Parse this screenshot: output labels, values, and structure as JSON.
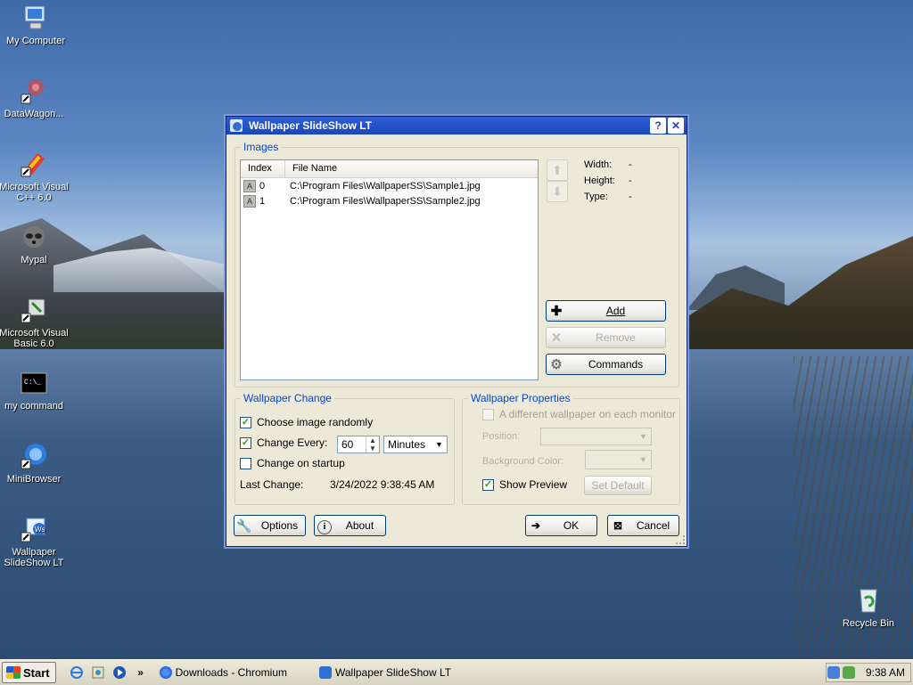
{
  "desktop": {
    "icons": [
      {
        "label": "My Computer"
      },
      {
        "label": "DataWagon..."
      },
      {
        "label": "Microsoft Visual C++ 6.0"
      },
      {
        "label": "Mypal"
      },
      {
        "label": "Microsoft Visual Basic 6.0"
      },
      {
        "label": "my command"
      },
      {
        "label": "MiniBrowser"
      },
      {
        "label": "Wallpaper SlideShow LT"
      },
      {
        "label": "Recycle Bin"
      }
    ]
  },
  "dialog": {
    "title": "Wallpaper SlideShow LT",
    "help_glyph": "?",
    "close_glyph": "✕",
    "images_group": {
      "title": "Images",
      "columns": [
        "Index",
        "File Name"
      ],
      "rows": [
        {
          "index": "0",
          "file": "C:\\Program Files\\WallpaperSS\\Sample1.jpg"
        },
        {
          "index": "1",
          "file": "C:\\Program Files\\WallpaperSS\\Sample2.jpg"
        }
      ],
      "width_label": "Width:",
      "width_value": "-",
      "height_label": "Height:",
      "height_value": "-",
      "type_label": "Type:",
      "type_value": "-",
      "add_label": "Add",
      "remove_label": "Remove",
      "commands_label": "Commands"
    },
    "wallpaper_change": {
      "title": "Wallpaper Change",
      "choose_random": {
        "label": "Choose image randomly",
        "checked": true
      },
      "change_every": {
        "label": "Change Every:",
        "checked": true,
        "value": "60",
        "unit": "Minutes"
      },
      "change_startup": {
        "label": "Change on startup",
        "checked": false
      },
      "last_change_label": "Last Change:",
      "last_change_value": "3/24/2022 9:38:45 AM"
    },
    "wallpaper_properties": {
      "title": "Wallpaper Properties",
      "different_each_monitor": {
        "label": "A different wallpaper on each monitor",
        "checked": false
      },
      "position_label": "Position:",
      "background_color_label": "Background Color:",
      "show_preview": {
        "label": "Show Preview",
        "checked": true
      },
      "set_default_label": "Set Default"
    },
    "buttons": {
      "options": "Options",
      "about": "About",
      "ok": "OK",
      "cancel": "Cancel"
    }
  },
  "taskbar": {
    "start_label": "Start",
    "overflow": "»",
    "tasks": [
      {
        "label": "Downloads - Chromium"
      },
      {
        "label": "Wallpaper SlideShow LT"
      }
    ],
    "clock": "9:38 AM"
  }
}
